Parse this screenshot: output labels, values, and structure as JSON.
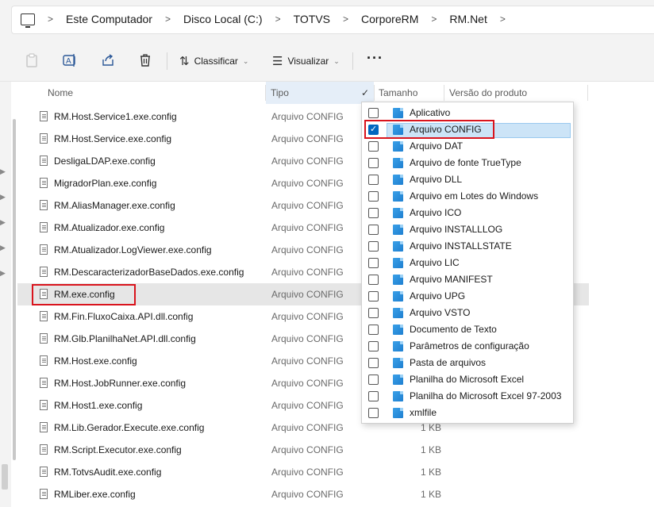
{
  "address": {
    "crumbs": [
      "Este Computador",
      "Disco Local (C:)",
      "TOTVS",
      "CorporeRM",
      "RM.Net"
    ]
  },
  "toolbar": {
    "sort_label": "Classificar",
    "view_label": "Visualizar",
    "more_label": "···"
  },
  "columns": {
    "name": "Nome",
    "type": "Tipo",
    "size": "Tamanho",
    "version": "Versão do produto",
    "type_check": "✓"
  },
  "files": [
    {
      "name": "RM.Host.Service1.exe.config",
      "type": "Arquivo CONFIG",
      "size": ""
    },
    {
      "name": "RM.Host.Service.exe.config",
      "type": "Arquivo CONFIG",
      "size": ""
    },
    {
      "name": "DesligaLDAP.exe.config",
      "type": "Arquivo CONFIG",
      "size": ""
    },
    {
      "name": "MigradorPlan.exe.config",
      "type": "Arquivo CONFIG",
      "size": ""
    },
    {
      "name": "RM.AliasManager.exe.config",
      "type": "Arquivo CONFIG",
      "size": ""
    },
    {
      "name": "RM.Atualizador.exe.config",
      "type": "Arquivo CONFIG",
      "size": ""
    },
    {
      "name": "RM.Atualizador.LogViewer.exe.config",
      "type": "Arquivo CONFIG",
      "size": ""
    },
    {
      "name": "RM.DescaracterizadorBaseDados.exe.config",
      "type": "Arquivo CONFIG",
      "size": ""
    },
    {
      "name": "RM.exe.config",
      "type": "Arquivo CONFIG",
      "size": ""
    },
    {
      "name": "RM.Fin.FluxoCaixa.API.dll.config",
      "type": "Arquivo CONFIG",
      "size": ""
    },
    {
      "name": "RM.Glb.PlanilhaNet.API.dll.config",
      "type": "Arquivo CONFIG",
      "size": ""
    },
    {
      "name": "RM.Host.exe.config",
      "type": "Arquivo CONFIG",
      "size": ""
    },
    {
      "name": "RM.Host.JobRunner.exe.config",
      "type": "Arquivo CONFIG",
      "size": ""
    },
    {
      "name": "RM.Host1.exe.config",
      "type": "Arquivo CONFIG",
      "size": ""
    },
    {
      "name": "RM.Lib.Gerador.Execute.exe.config",
      "type": "Arquivo CONFIG",
      "size": "1 KB"
    },
    {
      "name": "RM.Script.Executor.exe.config",
      "type": "Arquivo CONFIG",
      "size": "1 KB"
    },
    {
      "name": "RM.TotvsAudit.exe.config",
      "type": "Arquivo CONFIG",
      "size": "1 KB"
    },
    {
      "name": "RMLiber.exe.config",
      "type": "Arquivo CONFIG",
      "size": "1 KB"
    }
  ],
  "selected_file_index": 8,
  "type_filter": {
    "options": [
      {
        "label": "Aplicativo",
        "checked": false
      },
      {
        "label": "Arquivo CONFIG",
        "checked": true
      },
      {
        "label": "Arquivo DAT",
        "checked": false
      },
      {
        "label": "Arquivo de fonte TrueType",
        "checked": false
      },
      {
        "label": "Arquivo DLL",
        "checked": false
      },
      {
        "label": "Arquivo em Lotes do Windows",
        "checked": false
      },
      {
        "label": "Arquivo ICO",
        "checked": false
      },
      {
        "label": "Arquivo INSTALLLOG",
        "checked": false
      },
      {
        "label": "Arquivo INSTALLSTATE",
        "checked": false
      },
      {
        "label": "Arquivo LIC",
        "checked": false
      },
      {
        "label": "Arquivo MANIFEST",
        "checked": false
      },
      {
        "label": "Arquivo UPG",
        "checked": false
      },
      {
        "label": "Arquivo VSTO",
        "checked": false
      },
      {
        "label": "Documento de Texto",
        "checked": false
      },
      {
        "label": "Parâmetros de configuração",
        "checked": false
      },
      {
        "label": "Pasta de arquivos",
        "checked": false
      },
      {
        "label": "Planilha do Microsoft Excel",
        "checked": false
      },
      {
        "label": "Planilha do Microsoft Excel 97-2003",
        "checked": false
      },
      {
        "label": "xmlfile",
        "checked": false
      }
    ]
  },
  "colors": {
    "highlight": "#d9141d",
    "accent": "#0067c0"
  }
}
